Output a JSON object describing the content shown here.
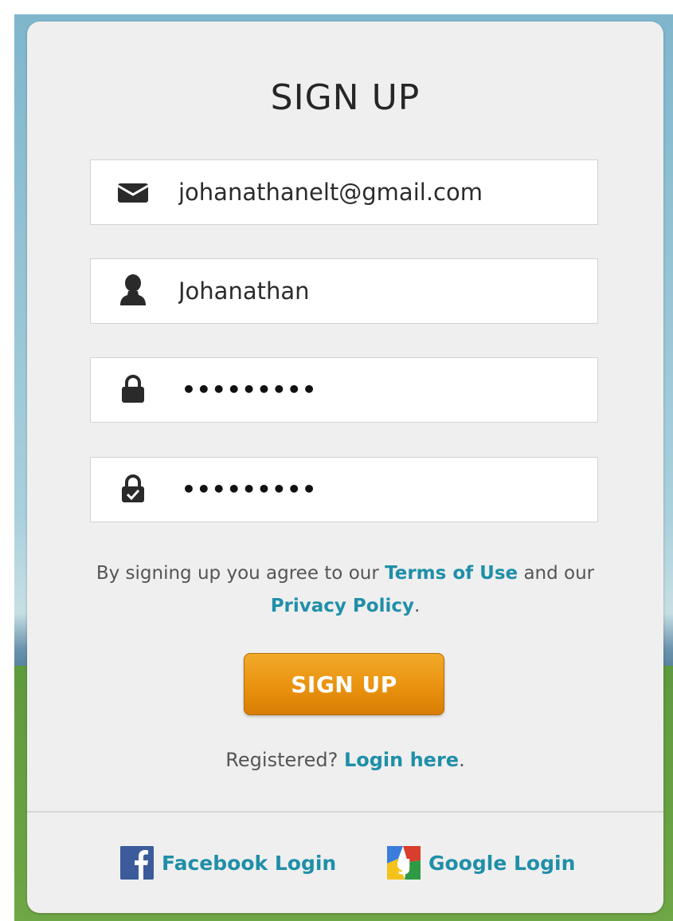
{
  "form": {
    "title": "SIGN UP",
    "email_value": "johanathanelt@gmail.com",
    "username_value": "Johanathan",
    "password_masked": "•••••••••",
    "confirm_password_masked": "•••••••••",
    "icons": {
      "email": "envelope-icon",
      "username": "user-icon",
      "password": "lock-icon",
      "confirm_password": "lock-check-icon"
    }
  },
  "terms": {
    "prefix": "By signing up you agree to our ",
    "terms_link": "Terms of Use",
    "middle": " and our",
    "privacy_link": "Privacy Policy",
    "suffix": "."
  },
  "submit": {
    "label": "SIGN UP"
  },
  "login": {
    "prefix": "Registered? ",
    "link": "Login here",
    "suffix": "."
  },
  "social": {
    "facebook_label": "Facebook Login",
    "google_label": "Google Login"
  },
  "colors": {
    "link": "#1f8fa8",
    "button": "#e8900d",
    "facebook": "#3b5b9a"
  }
}
